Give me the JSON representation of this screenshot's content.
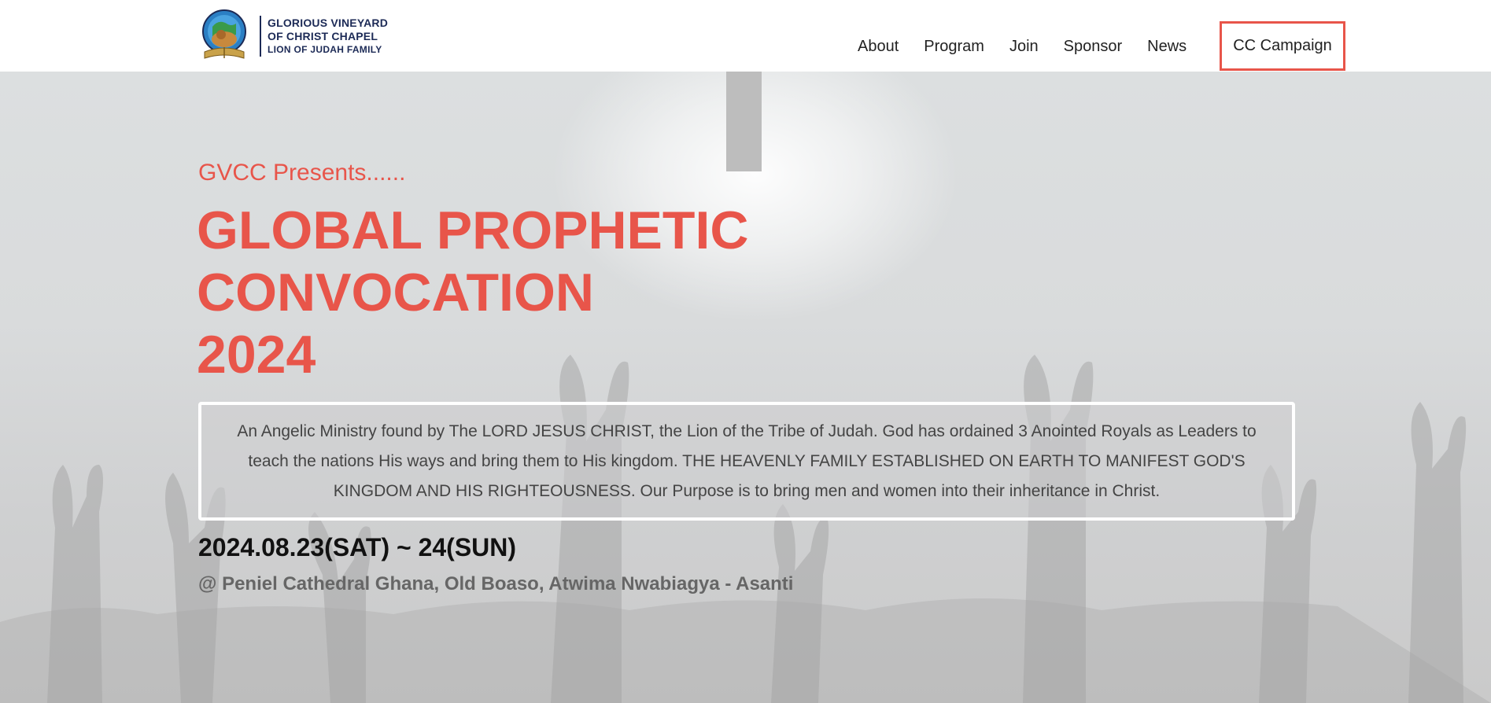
{
  "brand": {
    "line1": "GLORIOUS VINEYARD",
    "line2": "OF CHRIST CHAPEL",
    "line3": "LION OF JUDAH FAMILY"
  },
  "nav": {
    "items": [
      {
        "label": "About"
      },
      {
        "label": "Program"
      },
      {
        "label": "Join"
      },
      {
        "label": "Sponsor"
      },
      {
        "label": "News"
      }
    ],
    "cta_label": "CC Campaign"
  },
  "hero": {
    "presents": "GVCC Presents......",
    "title_line1": "GLOBAL PROPHETIC",
    "title_line2": "CONVOCATION",
    "title_line3": "2024",
    "description": "An Angelic Ministry found by The LORD JESUS CHRIST, the Lion of the Tribe of Judah. God has ordained 3 Anointed Royals as Leaders to teach the nations His ways and bring them to His kingdom. THE HEAVENLY FAMILY ESTABLISHED ON EARTH TO MANIFEST GOD'S KINGDOM AND HIS RIGHTEOUSNESS. Our Purpose is to bring men and women into their inheritance in Christ.",
    "dates": "2024.08.23(SAT) ~ 24(SUN)",
    "venue": "@ Peniel Cathedral Ghana, Old Boaso, Atwima Nwabiagya - Asanti"
  },
  "colors": {
    "accent": "#e8554a",
    "brand_navy": "#1c2a56",
    "hero_bg": "#d9dbdc"
  }
}
